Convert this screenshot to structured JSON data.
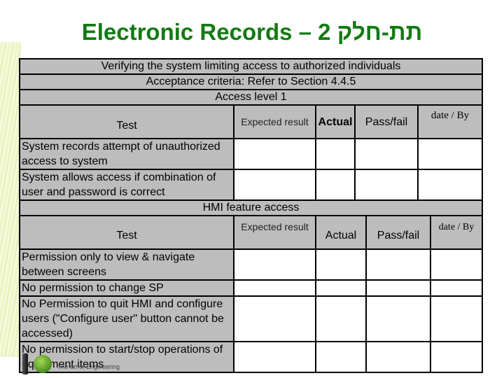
{
  "title": "Electronic Records – 2 תת-חלק",
  "section1": {
    "banner_rows": [
      "Verifying the system limiting access to authorized individuals",
      "Acceptance criteria: Refer to Section 4.4.5",
      "Access level 1"
    ],
    "headers": {
      "test": "Test",
      "expected": "Expected result",
      "actual": "Actual",
      "passfail": "Pass/fail",
      "dateby": "date / By"
    },
    "rows": [
      {
        "test": "System records attempt of unauthorized access to system",
        "expected": "",
        "actual": "",
        "passfail": "",
        "dateby": ""
      },
      {
        "test": "System allows access if combination of user and password is correct",
        "expected": "",
        "actual": "",
        "passfail": "",
        "dateby": ""
      }
    ]
  },
  "section2": {
    "banner": "HMI feature access",
    "headers": {
      "test": "Test",
      "expected": "Expected result",
      "actual": "Actual",
      "passfail": "Pass/fail",
      "dateby": "date / By"
    },
    "rows": [
      {
        "test": "Permission only to view & navigate between screens",
        "expected": "",
        "actual": "",
        "passfail": "",
        "dateby": ""
      },
      {
        "test": "No permission to change SP",
        "expected": "",
        "actual": "",
        "passfail": "",
        "dateby": ""
      },
      {
        "test": "No Permission to quit HMI and configure users (\"Configure user\" button cannot be accessed)",
        "expected": "",
        "actual": "",
        "passfail": "",
        "dateby": ""
      },
      {
        "test": "No permission to start/stop operations of equipment items",
        "expected": "",
        "actual": "",
        "passfail": "",
        "dateby": ""
      }
    ]
  },
  "logo": {
    "tagline": "The art of Engineering",
    "icon": "green-sphere-logo-icon"
  },
  "colors": {
    "title": "#137a13",
    "header_fill": "#bdbdbd",
    "cell_fill": "#ffffff",
    "border": "#000000"
  }
}
